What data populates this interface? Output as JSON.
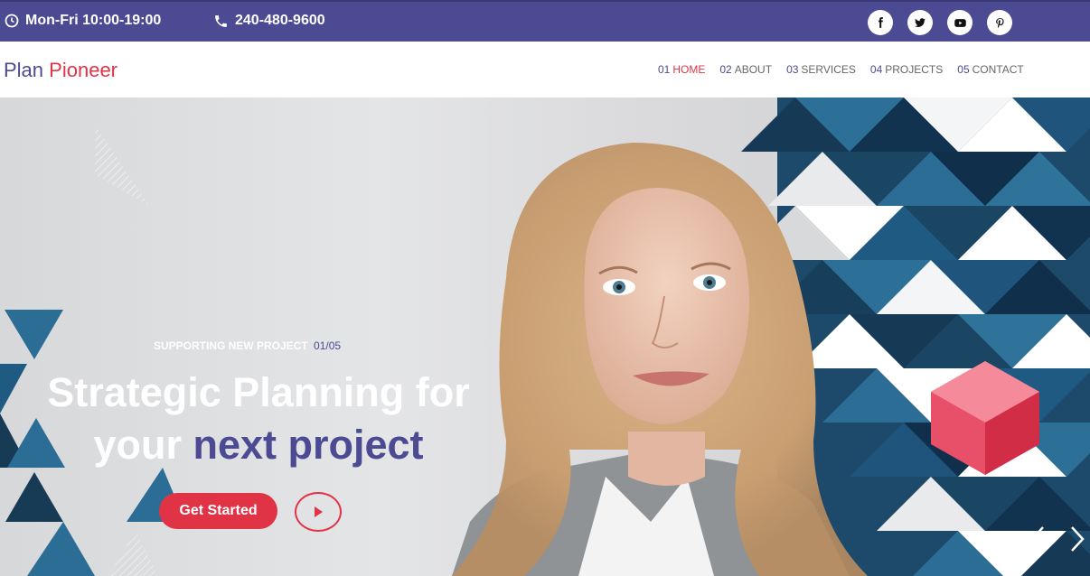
{
  "topbar": {
    "hours": "Mon-Fri 10:00-19:00",
    "phone": "240-480-9600",
    "icons": {
      "hours": "clock-icon",
      "phone": "phone-icon"
    },
    "socials": [
      "facebook-icon",
      "twitter-icon",
      "youtube-icon",
      "pinterest-icon"
    ]
  },
  "brand": {
    "part1": "Plan",
    "part2": "Pioneer"
  },
  "nav": [
    {
      "num": "01",
      "label": "HOME",
      "active": true
    },
    {
      "num": "02",
      "label": "ABOUT",
      "active": false
    },
    {
      "num": "03",
      "label": "SERVICES",
      "active": false
    },
    {
      "num": "04",
      "label": "PROJECTS",
      "active": false
    },
    {
      "num": "05",
      "label": "CONTACT",
      "active": false
    }
  ],
  "hero": {
    "tag": "SUPPORTING NEW PROJECT",
    "counter": "01/05",
    "headline_line1": "Strategic Planning for",
    "headline_white": "your",
    "headline_accent": "next project",
    "cta_label": "Get Started",
    "play_icon": "play-icon",
    "prev_icon": "chevron-left-icon",
    "next_icon": "chevron-right-icon"
  },
  "colors": {
    "primary": "#4b4a93",
    "accent": "#e03446",
    "navy": "#173a55",
    "blue": "#2b6d95"
  }
}
